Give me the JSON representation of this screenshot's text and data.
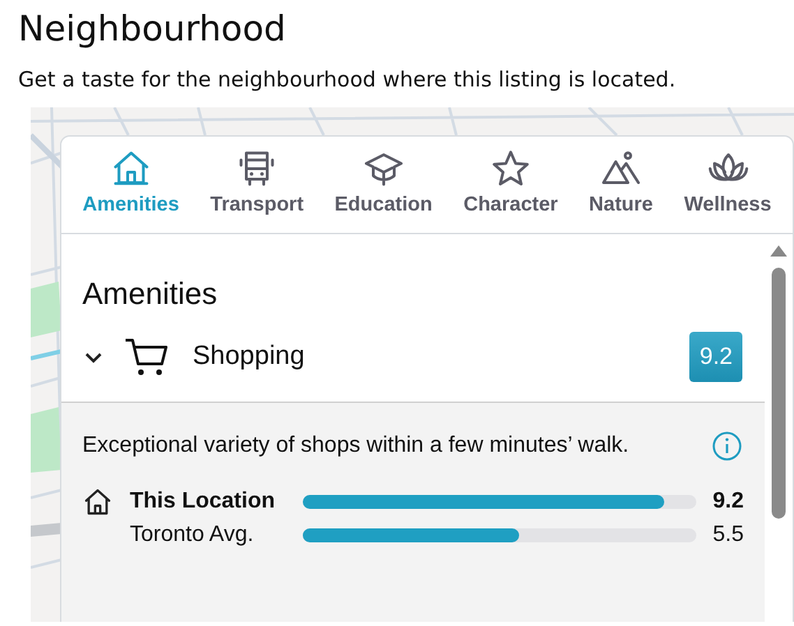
{
  "heading": "Neighbourhood",
  "subtitle": "Get a taste for the neighbourhood where this listing is located.",
  "tabs": [
    {
      "label": "Amenities",
      "kind": "house",
      "selected": true
    },
    {
      "label": "Transport",
      "kind": "bus",
      "selected": false
    },
    {
      "label": "Education",
      "kind": "cap",
      "selected": false
    },
    {
      "label": "Character",
      "kind": "star",
      "selected": false
    },
    {
      "label": "Nature",
      "kind": "mountain",
      "selected": false
    },
    {
      "label": "Wellness",
      "kind": "lotus",
      "selected": false
    }
  ],
  "section_title": "Amenities",
  "category": {
    "name": "Shopping",
    "score": "9.2",
    "expanded": true,
    "description": "Exceptional variety of shops within a few minutes’ walk.",
    "comparisons": [
      {
        "label": "This Location",
        "level": 0.92,
        "reading": "9.2",
        "kind": "primary"
      },
      {
        "label": "Toronto Avg.",
        "level": 0.55,
        "reading": "5.5",
        "kind": "average"
      }
    ]
  }
}
